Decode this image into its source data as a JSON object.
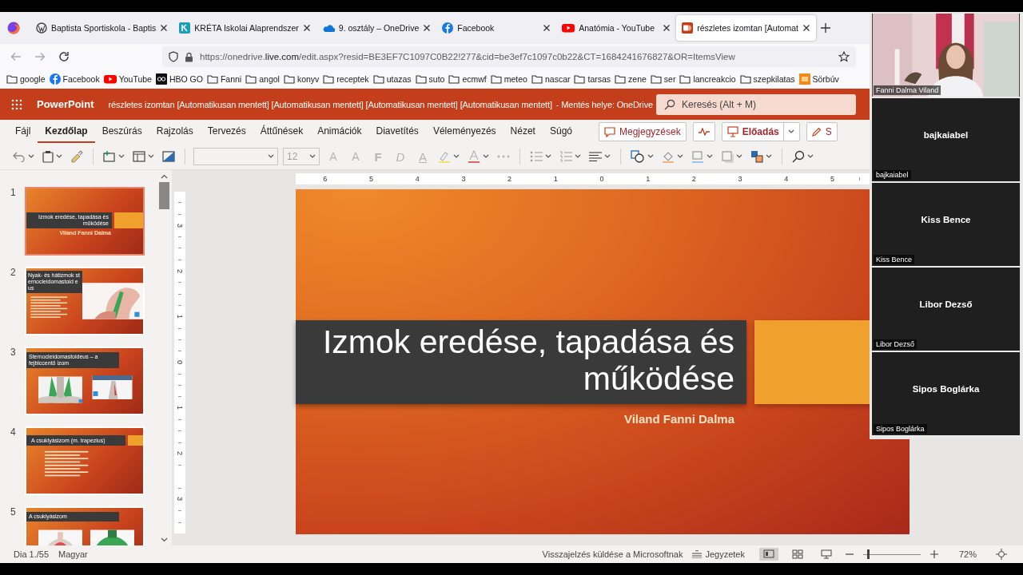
{
  "browser": {
    "tabs": [
      {
        "kind": "wordpress",
        "title": "Baptista Sportiskola - Baptis",
        "selected": false
      },
      {
        "kind": "kreta",
        "title": "KRÉTA Iskolai Alaprendszer",
        "selected": false
      },
      {
        "kind": "onedrive",
        "title": "9. osztály – OneDrive",
        "selected": false
      },
      {
        "kind": "facebook",
        "title": "Facebook",
        "selected": false
      },
      {
        "kind": "youtube",
        "title": "Anatómia - YouTube",
        "selected": false
      },
      {
        "kind": "powerpoint",
        "title": "részletes izomtan [Automat",
        "selected": true
      }
    ],
    "url": "https://onedrive.**live.com**/edit.aspx?resid=BE3EF7C1097C0B22!277&cid=be3ef7c1097c0b22&CT=1684241676827&OR=ItemsView",
    "bookmarks": [
      {
        "kind": "folder",
        "label": "google"
      },
      {
        "kind": "facebook",
        "label": "Facebook"
      },
      {
        "kind": "youtube",
        "label": "YouTube"
      },
      {
        "kind": "hbo",
        "label": "HBO GO"
      },
      {
        "kind": "folder",
        "label": "Fanni"
      },
      {
        "kind": "folder",
        "label": "angol"
      },
      {
        "kind": "folder",
        "label": "konyv"
      },
      {
        "kind": "folder",
        "label": "receptek"
      },
      {
        "kind": "folder",
        "label": "utazas"
      },
      {
        "kind": "folder",
        "label": "suto"
      },
      {
        "kind": "folder",
        "label": "ecmwf"
      },
      {
        "kind": "folder",
        "label": "meteo"
      },
      {
        "kind": "folder",
        "label": "nascar"
      },
      {
        "kind": "folder",
        "label": "tarsas"
      },
      {
        "kind": "folder",
        "label": "zene"
      },
      {
        "kind": "folder",
        "label": "ser"
      },
      {
        "kind": "folder",
        "label": "lancreakcio"
      },
      {
        "kind": "folder",
        "label": "szepkilatas"
      },
      {
        "kind": "site",
        "label": "Sörbúv"
      }
    ]
  },
  "app": {
    "name": "PowerPoint",
    "document_title": "részletes izomtan [Automatikusan mentett] [Automatikusan mentett] [Automatikusan mentett] [Automatikusan mentett]",
    "save_location": "- Mentés helye: OneDrive",
    "search_placeholder": "Keresés (Alt + M)"
  },
  "ribbon": {
    "tabs": [
      {
        "label": "Fájl",
        "selected": false
      },
      {
        "label": "Kezdőlap",
        "selected": true
      },
      {
        "label": "Beszúrás",
        "selected": false
      },
      {
        "label": "Rajzolás",
        "selected": false
      },
      {
        "label": "Tervezés",
        "selected": false
      },
      {
        "label": "Áttűnések",
        "selected": false
      },
      {
        "label": "Animációk",
        "selected": false
      },
      {
        "label": "Diavetítés",
        "selected": false
      },
      {
        "label": "Véleményezés",
        "selected": false
      },
      {
        "label": "Nézet",
        "selected": false
      },
      {
        "label": "Súgó",
        "selected": false
      }
    ],
    "comments_button": "Megjegyzések",
    "present_button": "Előadás",
    "edit_button": "S",
    "font_group": {
      "disabled": true,
      "size": "12",
      "grow": "A",
      "shrink": "A",
      "bold": "F",
      "italic": "D",
      "underline": "A"
    }
  },
  "thumbnails": [
    {
      "number": "1",
      "kind": "title",
      "title": "Izmok eredése, tapadása és működése",
      "subtitle": "Viland Fanni Dalma",
      "selected": true
    },
    {
      "number": "2",
      "kind": "text-picture",
      "title": "Nyak- és hátizmok sternocleidomastoid eus",
      "selected": false
    },
    {
      "number": "3",
      "kind": "pictures",
      "title": "Sternocleidomastoideus – a fejbiccentő izom",
      "selected": false
    },
    {
      "number": "4",
      "kind": "text",
      "title": "A csuklyásizom (m. trapezius)",
      "selected": false
    },
    {
      "number": "5",
      "kind": "pictures",
      "title": "A csuklyásizom",
      "selected": false
    }
  ],
  "rulers": {
    "horizontal": [
      "6",
      "5",
      "4",
      "3",
      "2",
      "1",
      "0",
      "1",
      "2",
      "3",
      "4",
      "5"
    ],
    "vertical": [
      "3",
      "2",
      "1",
      "0",
      "1",
      "2",
      "3"
    ]
  },
  "slide": {
    "title": "Izmok eredése, tapadása és működése",
    "subtitle": "Viland Fanni Dalma"
  },
  "status_bar": {
    "slide_counter": "Dia 1./55",
    "language": "Magyar",
    "feedback": "Visszajelzés küldése a Microsoftnak",
    "notes": "Jegyzetek",
    "views": [
      {
        "kind": "normal",
        "selected": true
      },
      {
        "kind": "sorter",
        "selected": false
      },
      {
        "kind": "reading",
        "selected": false
      }
    ],
    "zoom": {
      "level": 0.07,
      "reading": "72%"
    }
  },
  "meeting": {
    "participants": [
      {
        "kind": "video",
        "label": "Fanni Dalma Viland"
      },
      {
        "kind": "avatar",
        "name": "bajkaiabel",
        "label": "bajkaiabel"
      },
      {
        "kind": "avatar",
        "name": "Kiss Bence",
        "label": "Kiss Bence"
      },
      {
        "kind": "avatar",
        "name": "Libor Dezső",
        "label": "Libor Dezső"
      },
      {
        "kind": "avatar",
        "name": "Sipos Boglárka",
        "label": "Sipos Boglárka"
      }
    ]
  }
}
